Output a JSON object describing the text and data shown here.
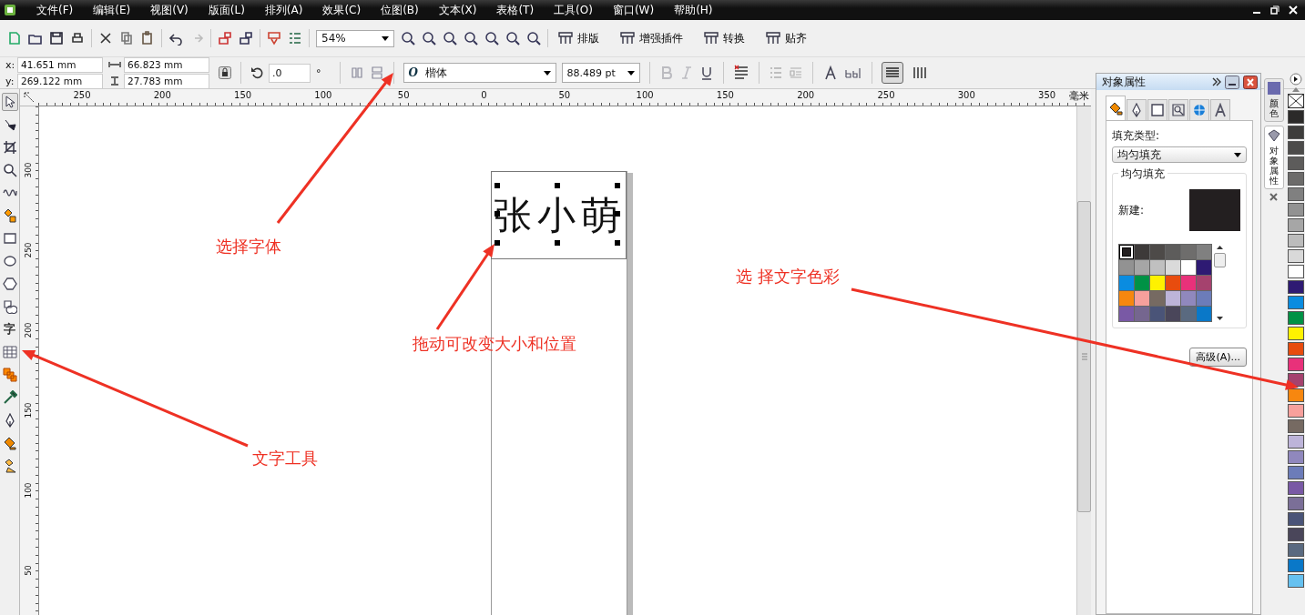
{
  "menu_bar": {
    "items": [
      "文件(F)",
      "编辑(E)",
      "视图(V)",
      "版面(L)",
      "排列(A)",
      "效果(C)",
      "位图(B)",
      "文本(X)",
      "表格(T)",
      "工具(O)",
      "窗口(W)",
      "帮助(H)"
    ]
  },
  "toolbar": {
    "zoom": "54%",
    "buttons": [
      "排版",
      "增强插件",
      "转换",
      "贴齐"
    ]
  },
  "property_bar": {
    "x_label": "x:",
    "x": "41.651 mm",
    "y_label": "y:",
    "y": "269.122 mm",
    "width": "66.823 mm",
    "height": "27.783 mm",
    "rotation": ".0",
    "degree_sign": "°",
    "font_glyph": "O",
    "font": "楷体",
    "font_size": "88.489 pt",
    "style_buttons": [
      {
        "kind": "bold",
        "disabled": true
      },
      {
        "kind": "italic",
        "disabled": true
      },
      {
        "kind": "underline",
        "disabled": false
      }
    ],
    "text_direction": [
      {
        "kind": "horizontal",
        "selected": true
      },
      {
        "kind": "vertical",
        "selected": false
      }
    ]
  },
  "rulers": {
    "horizontal": [
      "250",
      "200",
      "150",
      "100",
      "50",
      "0",
      "50",
      "100",
      "150",
      "200",
      "250",
      "300",
      "350"
    ],
    "unit": "毫米",
    "vertical": [
      "300",
      "250",
      "200",
      "150",
      "100",
      "50"
    ]
  },
  "toolbox": {
    "tools": [
      {
        "kind": "pick",
        "selected": true
      },
      {
        "kind": "shape",
        "selected": false
      },
      {
        "kind": "crop",
        "selected": false
      },
      {
        "kind": "zoom",
        "selected": false
      },
      {
        "kind": "freehand",
        "selected": false
      },
      {
        "kind": "smart-fill",
        "selected": false
      },
      {
        "kind": "rectangle",
        "selected": false
      },
      {
        "kind": "ellipse",
        "selected": false
      },
      {
        "kind": "polygon",
        "selected": false
      },
      {
        "kind": "basic-shapes",
        "selected": false
      },
      {
        "kind": "text",
        "label": "字",
        "selected": false
      },
      {
        "kind": "table",
        "selected": false
      },
      {
        "kind": "blend",
        "selected": false
      },
      {
        "kind": "eyedropper",
        "selected": false
      },
      {
        "kind": "outline",
        "selected": false
      },
      {
        "kind": "fill",
        "selected": false
      },
      {
        "kind": "interactive-fill",
        "selected": false
      }
    ]
  },
  "canvas": {
    "text": "张小萌"
  },
  "annotations": [
    {
      "text": "选择字体"
    },
    {
      "text": "拖动可改变大小和位置"
    },
    {
      "text": "选 择文字色彩"
    },
    {
      "text": "文字工具"
    }
  ],
  "docker": {
    "title": "对象属性",
    "tabs": [
      {
        "kind": "fill",
        "selected": true
      },
      {
        "kind": "outline",
        "selected": false
      },
      {
        "kind": "frame",
        "selected": false
      },
      {
        "kind": "zoom",
        "selected": false
      },
      {
        "kind": "internet",
        "selected": false
      },
      {
        "kind": "text",
        "selected": false
      }
    ],
    "fill_type_label": "填充类型:",
    "fill_type": "均匀填充",
    "group_title": "均匀填充",
    "new_label": "新建:",
    "swatches": [
      {
        "color": "#231f20",
        "selected": true
      },
      {
        "color": "#3d3a39",
        "selected": false
      },
      {
        "color": "#4d4a48",
        "selected": false
      },
      {
        "color": "#5d5c5b",
        "selected": false
      },
      {
        "color": "#6e6d6c",
        "selected": false
      },
      {
        "color": "#808080",
        "selected": false
      },
      {
        "color": "#929292",
        "selected": false
      },
      {
        "color": "#a6a6a6",
        "selected": false
      },
      {
        "color": "#c0c0c0",
        "selected": false
      },
      {
        "color": "#dadada",
        "selected": false
      },
      {
        "color": "#ffffff",
        "selected": false
      },
      {
        "color": "#2e1a73",
        "selected": false
      },
      {
        "color": "#0a8ce0",
        "selected": false
      },
      {
        "color": "#009245",
        "selected": false
      },
      {
        "color": "#fff200",
        "selected": false
      },
      {
        "color": "#e84c0e",
        "selected": false
      },
      {
        "color": "#e8317a",
        "selected": false
      },
      {
        "color": "#a5426e",
        "selected": false
      },
      {
        "color": "#f7870f",
        "selected": false
      },
      {
        "color": "#f7a09c",
        "selected": false
      },
      {
        "color": "#766a62",
        "selected": false
      },
      {
        "color": "#bdb4d9",
        "selected": false
      },
      {
        "color": "#9088bd",
        "selected": false
      },
      {
        "color": "#6c7cb9",
        "selected": false
      },
      {
        "color": "#7959a5",
        "selected": false
      },
      {
        "color": "#75668f",
        "selected": false
      },
      {
        "color": "#4a5478",
        "selected": false
      },
      {
        "color": "#4a465a",
        "selected": false
      },
      {
        "color": "#5a6a80",
        "selected": false
      },
      {
        "color": "#0a78c8",
        "selected": false
      }
    ],
    "advanced_button": "高级(A)..."
  },
  "side_tabs": [
    {
      "kind": "color",
      "label": "颜色",
      "selected": false
    },
    {
      "kind": "object-properties",
      "label": "对象属性",
      "selected": true
    }
  ],
  "palette": [
    {
      "kind": "none"
    },
    {
      "kind": "color",
      "color": "#2b2a29"
    },
    {
      "kind": "color",
      "color": "#3e3d3c"
    },
    {
      "kind": "color",
      "color": "#4c4b4a"
    },
    {
      "kind": "color",
      "color": "#5d5c5b"
    },
    {
      "kind": "color",
      "color": "#6c6b6a"
    },
    {
      "kind": "color",
      "color": "#808080"
    },
    {
      "kind": "color",
      "color": "#929292"
    },
    {
      "kind": "color",
      "color": "#a6a6a6"
    },
    {
      "kind": "color",
      "color": "#bcbcbc"
    },
    {
      "kind": "color",
      "color": "#d9d9d9"
    },
    {
      "kind": "color",
      "color": "#ffffff"
    },
    {
      "kind": "color",
      "color": "#2e1a73"
    },
    {
      "kind": "color",
      "color": "#0a8ce0"
    },
    {
      "kind": "color",
      "color": "#009245"
    },
    {
      "kind": "color",
      "color": "#fff200"
    },
    {
      "kind": "color",
      "color": "#e84c0e"
    },
    {
      "kind": "color",
      "color": "#e8317a"
    },
    {
      "kind": "color",
      "color": "#a5426e"
    },
    {
      "kind": "color",
      "color": "#f7870f"
    },
    {
      "kind": "color",
      "color": "#f7a09c"
    },
    {
      "kind": "color",
      "color": "#766a62"
    },
    {
      "kind": "color",
      "color": "#bdb4d9"
    },
    {
      "kind": "color",
      "color": "#9088bd"
    },
    {
      "kind": "color",
      "color": "#6c7cb9"
    },
    {
      "kind": "color",
      "color": "#7959a5"
    },
    {
      "kind": "color",
      "color": "#7b6f98"
    },
    {
      "kind": "color",
      "color": "#4a5478"
    },
    {
      "kind": "color",
      "color": "#4a465a"
    },
    {
      "kind": "color",
      "color": "#5a6a80"
    },
    {
      "kind": "color",
      "color": "#0a78c8"
    },
    {
      "kind": "color",
      "color": "#66c1f0"
    }
  ]
}
